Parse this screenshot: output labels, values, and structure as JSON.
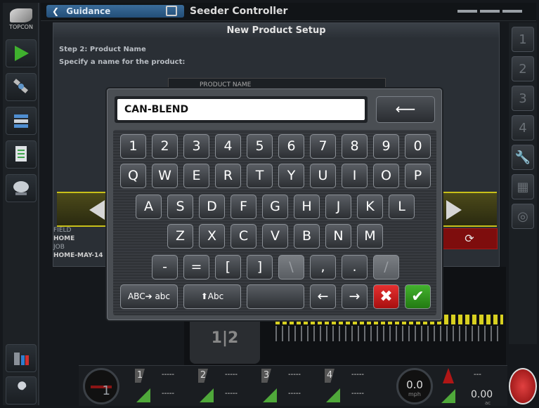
{
  "topbar": {
    "guidance_label": "Guidance",
    "title": "Seeder Controller"
  },
  "left_rail": {
    "logo_text": "TOPCON"
  },
  "right_rail": {
    "buttons": [
      "1",
      "2",
      "3",
      "4"
    ]
  },
  "setup": {
    "title": "New Product Setup",
    "step": "Step 2: Product Name",
    "instruction": "Specify a name for the product:",
    "product_name_label": "PRODUCT NAME"
  },
  "info": {
    "field_label": "FIELD",
    "field_value": "HOME",
    "job_label": "JOB",
    "job_value": "HOME-MAY-14"
  },
  "machine": {
    "section_label": "1|2"
  },
  "keyboard": {
    "entry_value": "CAN-BLEND",
    "backspace": "⟵",
    "row1": [
      "1",
      "2",
      "3",
      "4",
      "5",
      "6",
      "7",
      "8",
      "9",
      "0"
    ],
    "row2": [
      "Q",
      "W",
      "E",
      "R",
      "T",
      "Y",
      "U",
      "I",
      "O",
      "P"
    ],
    "row3": [
      "A",
      "S",
      "D",
      "F",
      "G",
      "H",
      "J",
      "K",
      "L"
    ],
    "row4": [
      "Z",
      "X",
      "C",
      "V",
      "B",
      "N",
      "M"
    ],
    "row5": [
      "-",
      "=",
      "[",
      "]",
      "\\",
      ",",
      ".",
      "/"
    ],
    "case_toggle": "ABC➔ abc",
    "shift": "⬆Abc",
    "space": "",
    "left": "←",
    "right": "→",
    "cancel": "✖",
    "ok": "✔"
  },
  "bottom": {
    "gauge_value": "1",
    "sections": [
      {
        "num": "1",
        "top": "-----",
        "bottom": "-----"
      },
      {
        "num": "2",
        "top": "-----",
        "bottom": "-----"
      },
      {
        "num": "3",
        "top": "-----",
        "bottom": "-----"
      },
      {
        "num": "4",
        "top": "-----",
        "bottom": "-----"
      }
    ],
    "speed_value": "0.0",
    "speed_unit": "mph",
    "area_top": "---",
    "area_value": "0.00",
    "area_unit": "ac"
  },
  "colors": {
    "accent_blue": "#2f5f8e",
    "boom_yellow": "#d8d020",
    "cancel_red": "#d42020",
    "ok_green": "#35a020"
  }
}
